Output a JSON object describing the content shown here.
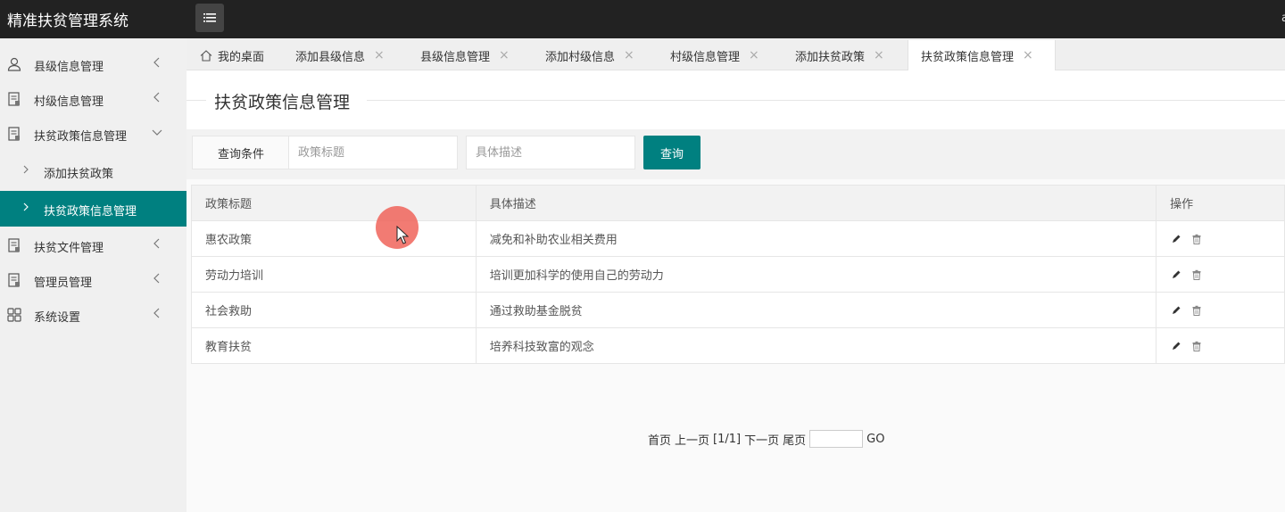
{
  "app": {
    "title": "精准扶贫管理系统",
    "top_right_text": "a"
  },
  "sidebar": {
    "items": [
      {
        "label": "县级信息管理",
        "icon": "user-icon"
      },
      {
        "label": "村级信息管理",
        "icon": "document-icon"
      },
      {
        "label": "扶贫政策信息管理",
        "icon": "document-icon",
        "expanded": true
      },
      {
        "label": "扶贫文件管理",
        "icon": "document-icon"
      },
      {
        "label": "管理员管理",
        "icon": "document-icon"
      },
      {
        "label": "系统设置",
        "icon": "grid-icon"
      }
    ],
    "subitems": [
      {
        "label": "添加扶贫政策"
      },
      {
        "label": "扶贫政策信息管理",
        "active": true
      }
    ],
    "active_color": "#008080"
  },
  "tabs": [
    {
      "label": "我的桌面",
      "icon": "home-icon"
    },
    {
      "label": "添加县级信息",
      "close": "×"
    },
    {
      "label": "县级信息管理",
      "close": "×"
    },
    {
      "label": "添加村级信息",
      "close": "×"
    },
    {
      "label": "村级信息管理",
      "close": "×"
    },
    {
      "label": "添加扶贫政策",
      "close": "×"
    },
    {
      "label": "扶贫政策信息管理",
      "close": "×",
      "active": true
    }
  ],
  "page": {
    "title": "扶贫政策信息管理"
  },
  "search": {
    "label": "查询条件",
    "title_placeholder": "政策标题",
    "desc_placeholder": "具体描述",
    "button": "查询"
  },
  "table": {
    "headers": [
      "政策标题",
      "具体描述",
      "操作"
    ],
    "rows": [
      [
        "惠农政策",
        "减免和补助农业相关费用"
      ],
      [
        "劳动力培训",
        "培训更加科学的使用自己的劳动力"
      ],
      [
        "社会救助",
        "通过救助基金脱贫"
      ],
      [
        "教育扶贫",
        "培养科技致富的观念"
      ]
    ],
    "row_actions": [
      "edit-icon",
      "delete-icon"
    ]
  },
  "pagination": {
    "first": "首页",
    "prev": "上一页",
    "current": "[1/1]",
    "next": "下一页",
    "last": "尾页",
    "go": "GO"
  }
}
